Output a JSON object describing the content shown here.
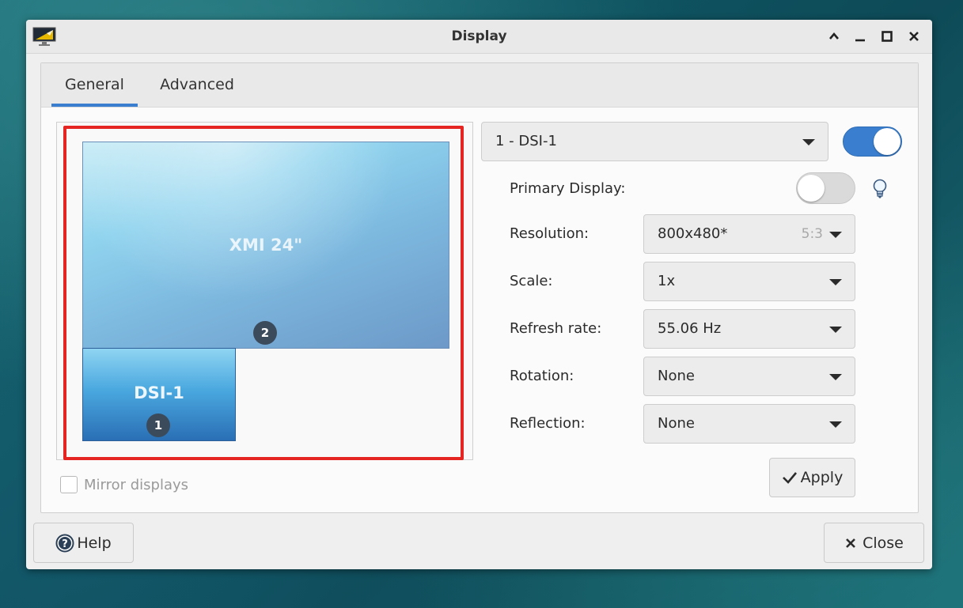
{
  "window": {
    "title": "Display"
  },
  "tabs": [
    {
      "label": "General",
      "active": true
    },
    {
      "label": "Advanced",
      "active": false
    }
  ],
  "layout": {
    "monitors": [
      {
        "label": "XMI 24\"",
        "number": "2"
      },
      {
        "label": "DSI-1",
        "number": "1"
      }
    ],
    "mirror_label": "Mirror displays",
    "mirror_checked": false
  },
  "display_select": {
    "value": "1 - DSI-1",
    "enabled": true
  },
  "properties": {
    "primary_label": "Primary Display:",
    "primary_on": false,
    "resolution_label": "Resolution:",
    "resolution_value": "800x480*",
    "resolution_ratio": "5:3",
    "scale_label": "Scale:",
    "scale_value": "1x",
    "refresh_label": "Refresh rate:",
    "refresh_value": "55.06 Hz",
    "rotation_label": "Rotation:",
    "rotation_value": "None",
    "reflection_label": "Reflection:",
    "reflection_value": "None"
  },
  "buttons": {
    "apply": "Apply",
    "help": "Help",
    "close": "Close"
  },
  "colors": {
    "accent": "#3a7fcf",
    "highlight": "#e52521"
  }
}
